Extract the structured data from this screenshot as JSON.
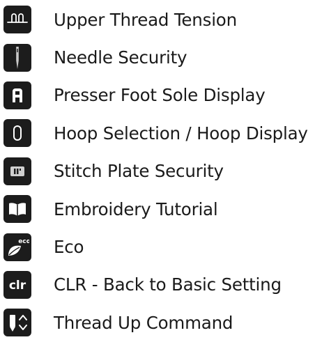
{
  "legend": {
    "items": [
      {
        "icon": "upper-thread-tension-icon",
        "label": "Upper Thread Tension"
      },
      {
        "icon": "needle-icon",
        "label": "Needle Security"
      },
      {
        "icon": "presser-foot-sole-icon",
        "label": "Presser Foot Sole Display"
      },
      {
        "icon": "hoop-icon",
        "label": "Hoop Selection / Hoop Display"
      },
      {
        "icon": "stitch-plate-icon",
        "label": "Stitch Plate Security"
      },
      {
        "icon": "tutorial-book-icon",
        "label": "Embroidery Tutorial"
      },
      {
        "icon": "eco-leaf-icon",
        "label": "Eco",
        "icon_text": "eco"
      },
      {
        "icon": "clr-icon",
        "label": "CLR - Back to Basic Setting",
        "icon_text": "clr"
      },
      {
        "icon": "thread-up-icon",
        "label": "Thread Up Command"
      }
    ]
  },
  "colors": {
    "icon_background": "#1c1c1c",
    "icon_foreground": "#ffffff",
    "needle_accent": "#c8c8c8",
    "text": "#1a1a1a"
  }
}
